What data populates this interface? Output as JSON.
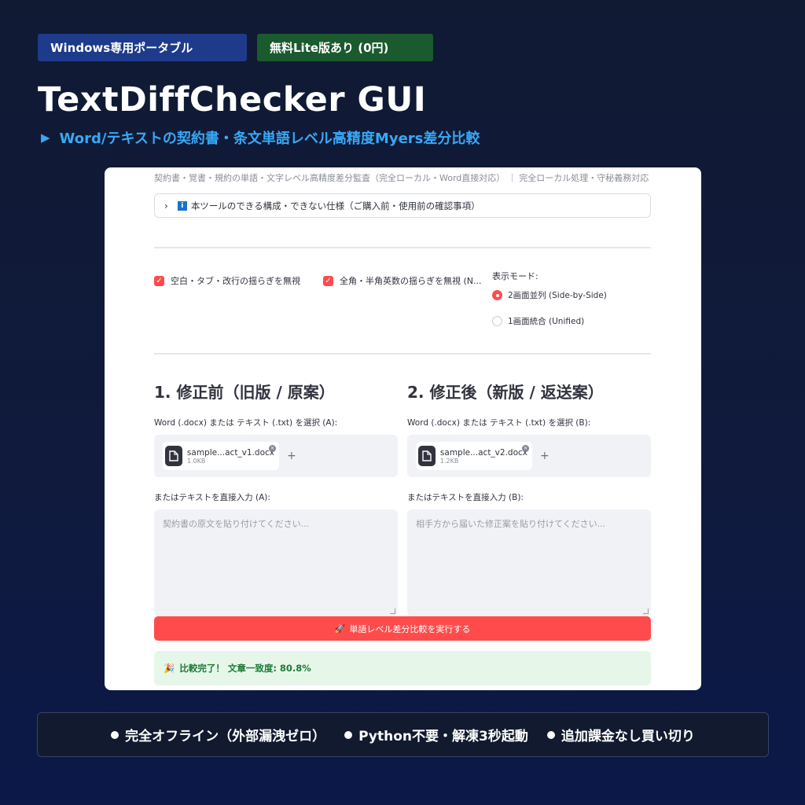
{
  "badges": {
    "platform": "Windows専用ポータブル",
    "lite": "無料Lite版あり (0円)"
  },
  "hero": {
    "title": "TextDiffChecker GUI",
    "subtitle": "Word/テキストの契約書・条文単語レベル高精度Myers差分比較"
  },
  "app": {
    "caption": "契約書・覚書・規約の単語・文字レベル高精度差分監査（完全ローカル・Word直接対応） ｜ 完全ローカル処理・守秘義務対応",
    "expander_label": "本ツールのできる構成・できない仕様（ご購入前・使用前の確認事項）",
    "options": {
      "ignore_whitespace": "空白・タブ・改行の揺らぎを無視",
      "ignore_width": "全角・半角英数の揺らぎを無視 (N...",
      "display_mode_label": "表示モード:",
      "mode_side_by_side": "2画面並列 (Side-by-Side)",
      "mode_unified": "1画面統合 (Unified)"
    },
    "before": {
      "title": "1. 修正前（旧版 / 原案）",
      "file_label": "Word (.docx) または テキスト (.txt) を選択 (A):",
      "file_name": "sample...act_v1.docx",
      "file_size": "1.0KB",
      "text_label": "またはテキストを直接入力 (A):",
      "text_placeholder": "契約書の原文を貼り付けてください..."
    },
    "after": {
      "title": "2. 修正後（新版 / 返送案）",
      "file_label": "Word (.docx) または テキスト (.txt) を選択 (B):",
      "file_name": "sample...act_v2.docx",
      "file_size": "1.2KB",
      "text_label": "またはテキストを直接入力 (B):",
      "text_placeholder": "相手方から届いた修正案を貼り付けてください..."
    },
    "run_button": "単語レベル差分比較を実行する",
    "result": "比較完了！ 文章一致度: 80.8%"
  },
  "footer": {
    "item1": "完全オフライン（外部漏洩ゼロ）",
    "item2": "Python不要・解凍3秒起動",
    "item3": "追加課金なし買い切り"
  },
  "colors": {
    "accent": "#ff4b4b",
    "hero_sub": "#38a8f5",
    "badge_blue": "#1e3a8a",
    "badge_green": "#1a5a2e"
  },
  "icons": {
    "expander": "chevron-right-icon",
    "info": "info-icon",
    "file": "document-icon",
    "rocket": "rocket-icon",
    "party": "party-popper-icon"
  }
}
